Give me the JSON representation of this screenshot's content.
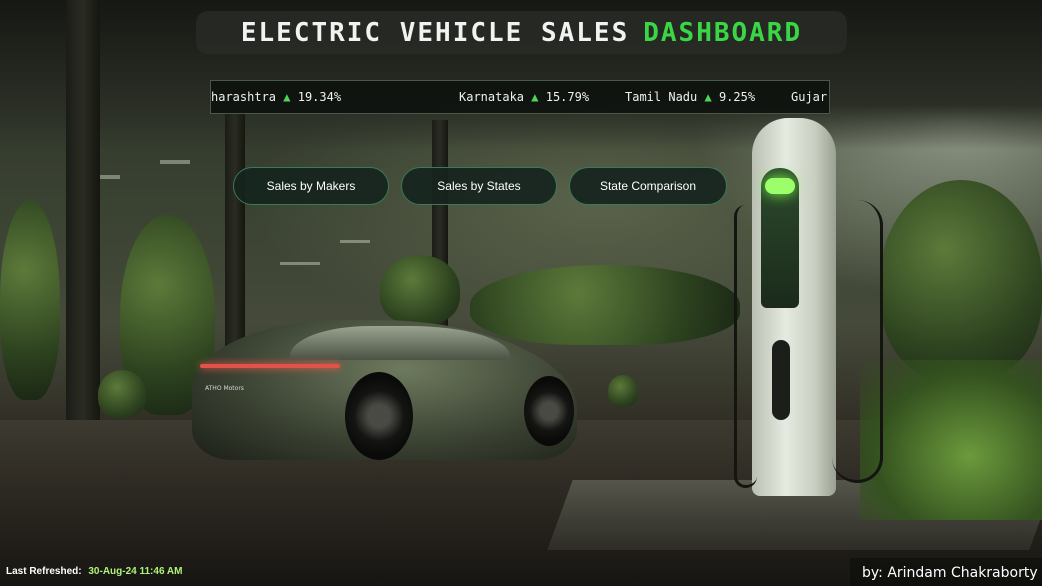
{
  "title": {
    "main": "ELECTRIC VEHICLE SALES",
    "accent": "DASHBOARD",
    "accent_color": "#3bd646"
  },
  "ticker": {
    "items": [
      {
        "state": "harashtra",
        "arrow": "▲",
        "value": "19.34%"
      },
      {
        "state": "Karnataka",
        "arrow": "▲",
        "value": "15.79%"
      },
      {
        "state": "Tamil Nadu",
        "arrow": "▲",
        "value": "9.25%"
      },
      {
        "state": "Gujar",
        "arrow": "",
        "value": ""
      }
    ]
  },
  "nav": {
    "makers": "Sales by Makers",
    "states": "Sales by States",
    "comparison": "State Comparison"
  },
  "car": {
    "brand": "ATHO Motors"
  },
  "footer": {
    "refresh_label": "Last Refreshed:",
    "refresh_value": "30-Aug-24 11:46 AM",
    "author": "by: Arindam Chakraborty"
  }
}
